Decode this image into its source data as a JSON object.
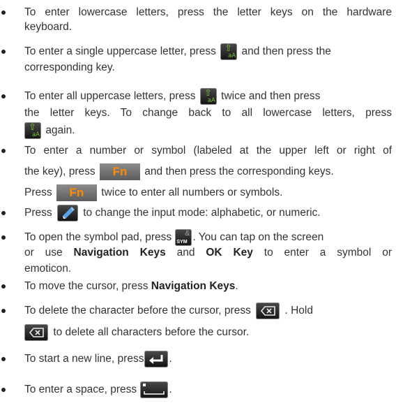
{
  "items": [
    {
      "lines": [
        "To enter lowercase letters, press the letter keys on the hardware",
        "keyboard."
      ]
    },
    {
      "a": "To enter a single uppercase letter, press",
      "b": "and then press the",
      "c": "corresponding key."
    },
    {
      "a": "To enter all uppercase letters, press",
      "b": "twice and then press",
      "c": "the letter keys. To change back to all lowercase letters, press",
      "d": "again."
    },
    {
      "a": "To enter a number or symbol (labeled at the upper left or right of",
      "b1": "the key), press",
      "b2": "and then press the corresponding keys.",
      "c1": "Press",
      "c2": "twice to enter all numbers or symbols."
    },
    {
      "a": "Press",
      "b": "to change the input mode: alphabetic, or numeric."
    },
    {
      "a": "To open the symbol pad, press",
      "b": ". You can tap on the screen",
      "c1": "or use",
      "c_bold1": "Navigation Keys",
      "c2": "and",
      "c_bold2": "OK Key",
      "c3": "to enter a symbol or",
      "d": "emoticon."
    },
    {
      "a": "To move the cursor, press",
      "bold": "Navigation Keys",
      "b": "."
    },
    {
      "a": "To delete the character before the cursor, press",
      "b": ". Hold",
      "c": "to delete all characters before the cursor."
    },
    {
      "a": "To start a new line, press",
      "b": "."
    },
    {
      "a": "To enter a space, press",
      "b": "."
    }
  ],
  "keys": {
    "shift_arrow": "⇧",
    "shift_sub": "aA",
    "fn": "Fn",
    "sym_top": "&",
    "sym_label": "SYM"
  },
  "colors": {
    "shift_glyph": "#7ac43c",
    "fn_text": "#ff8a00"
  }
}
